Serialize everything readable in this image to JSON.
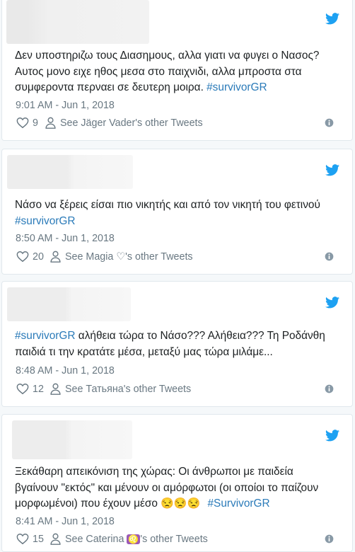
{
  "colors": {
    "accent": "#1da1f2",
    "link": "#2b7bb9",
    "muted": "#697882"
  },
  "tweets": [
    {
      "text_lines": [
        "Δεν υποστηριζω τους Διασημους, αλλα γιατι να φυγει ο Νασος?",
        "Αυτος μονο ειχε ηθος μεσα στο παιχνιδι, αλλα μπροστα στα",
        "συμφεροντα περναει σε δευτερη μοιρα."
      ],
      "hashtag": "#survivorGR",
      "timestamp": "9:01 AM - Jun 1, 2018",
      "likes": "9",
      "see_other": "See Jäger Vader's other Tweets"
    },
    {
      "text_lines": [
        "Νάσο να ξέρεις είσαι πιο νικητής και από τον νικητή του φετινού"
      ],
      "hashtag": "#survivorGR",
      "timestamp": "8:50 AM - Jun 1, 2018",
      "likes": "20",
      "see_other": "See Magia ♡'s other Tweets"
    },
    {
      "hashtag": "#survivorGR",
      "text_lines": [
        " αλήθεια τώρα το Νάσο??? Αλήθεια??? Τη Ροδάνθη",
        "παιδιά τι την κρατάτε μέσα, μεταξύ μας τώρα μιλάμε..."
      ],
      "timestamp": "8:48 AM - Jun 1, 2018",
      "likes": "12",
      "see_other": "See Татьяна's other Tweets"
    },
    {
      "text_lines": [
        "Ξεκάθαρη απεικόνιση της χώρας: Οι άνθρωποι με παιδεία",
        "βγαίνουν \"εκτός\" και μένουν οι αμόρφωτοι (οι οποίοι το παίζουν",
        "μορφωμένοι) που έχουν μέσο"
      ],
      "emoji": "😒😒😒",
      "hashtag": "#SurvivorGR",
      "timestamp": "8:41 AM - Jun 1, 2018",
      "likes": "15",
      "see_other_prefix": "See Caterina ",
      "see_other_symbol": "♌",
      "see_other_suffix": "'s other Tweets"
    }
  ],
  "icons": {
    "brand": "twitter-bird-icon",
    "like": "heart-outline-icon",
    "profile": "person-icon",
    "info": "info-icon"
  }
}
